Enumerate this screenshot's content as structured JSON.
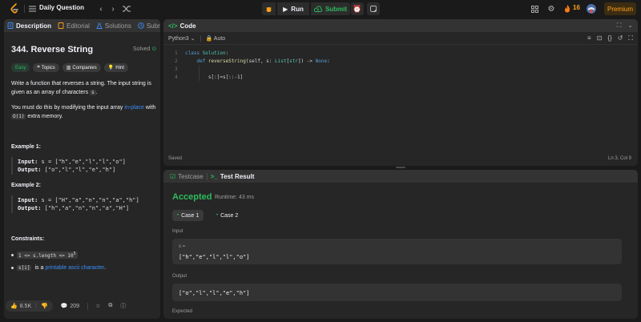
{
  "topbar": {
    "title": "Daily Question",
    "run_label": "Run",
    "submit_label": "Submit",
    "streak_count": "16",
    "premium_label": "Premium"
  },
  "left": {
    "tabs": [
      {
        "label": "Description"
      },
      {
        "label": "Editorial"
      },
      {
        "label": "Solutions"
      },
      {
        "label": "Subm"
      }
    ],
    "problem_title": "344. Reverse String",
    "status": "Solved",
    "tags": [
      {
        "label": "Easy"
      },
      {
        "label": "Topics"
      },
      {
        "label": "Companies"
      },
      {
        "label": "Hint"
      }
    ],
    "p1_a": "Write a function that reverses a string. The input string is given as an array of characters",
    "p1_code": "s",
    "p1_end": ".",
    "p2_a": "You must do this by modifying the input array",
    "p2_link": "in-place",
    "p2_b": "with",
    "p2_code": "O(1)",
    "p2_end": "extra memory.",
    "example1": {
      "heading": "Example 1:",
      "input_label": "Input:",
      "input_value": "s = [\"h\",\"e\",\"l\",\"l\",\"o\"]",
      "output_label": "Output:",
      "output_value": "[\"o\",\"l\",\"l\",\"e\",\"h\"]"
    },
    "example2": {
      "heading": "Example 2:",
      "input_label": "Input:",
      "input_value": "s = [\"H\",\"a\",\"n\",\"n\",\"a\",\"h\"]",
      "output_label": "Output:",
      "output_value": "[\"h\",\"a\",\"n\",\"n\",\"a\",\"H\"]"
    },
    "constraints_heading": "Constraints:",
    "constraint1": "1 <= s.length <= 10",
    "constraint1_sup": "5",
    "constraint2_code": "s[i]",
    "constraint2_a": "is a",
    "constraint2_link": "printable ascii character",
    "constraint2_end": ".",
    "likes": "8.5K",
    "comments": "209"
  },
  "code": {
    "tab_label": "Code",
    "language": "Python3",
    "auto_label": "Auto",
    "lines": [
      "1",
      "2",
      "3",
      "4"
    ],
    "status": "Saved",
    "cursor": "Ln 3, Col 9"
  },
  "result": {
    "tab_testcase": "Testcase",
    "tab_result": "Test Result",
    "verdict": "Accepted",
    "runtime": "Runtime: 43 ms",
    "case1": "Case 1",
    "case2": "Case 2",
    "input_label": "Input",
    "input_var": "s =",
    "input_value": "[\"h\",\"e\",\"l\",\"l\",\"o\"]",
    "output_label": "Output",
    "output_value": "[\"o\",\"l\",\"l\",\"e\",\"h\"]",
    "expected_label": "Expected"
  },
  "colors": {
    "accent_orange": "#ffa116",
    "accepted_green": "#2cbb5d",
    "link_blue": "#3c8ffa"
  }
}
